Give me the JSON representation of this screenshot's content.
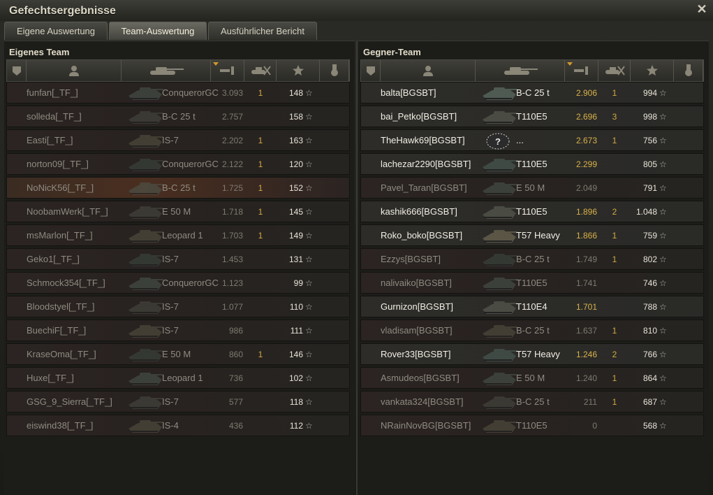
{
  "window": {
    "title": "Gefechtsergebnisse"
  },
  "tabs": [
    {
      "label": "Eigene Auswertung",
      "active": false
    },
    {
      "label": "Team-Auswertung",
      "active": true
    },
    {
      "label": "Ausführlicher Bericht",
      "active": false
    }
  ],
  "left_team": {
    "title": "Eigenes Team",
    "columns": [
      "squad-icon",
      "player-icon",
      "tank-icon",
      "rating-icon",
      "kills-icon",
      "xp-star-icon",
      "medal-icon"
    ],
    "rows": [
      {
        "name": "funfan[_TF_]",
        "vehicle": "ConquerorGC",
        "rating": "3.093",
        "kills": "1",
        "xp": "148",
        "alive": false,
        "hl": false
      },
      {
        "name": "solleda[_TF_]",
        "vehicle": "B-C 25 t",
        "rating": "2.757",
        "kills": "",
        "xp": "158",
        "alive": false,
        "hl": false
      },
      {
        "name": "Easti[_TF_]",
        "vehicle": "IS-7",
        "rating": "2.202",
        "kills": "1",
        "xp": "163",
        "alive": false,
        "hl": false
      },
      {
        "name": "norton09[_TF_]",
        "vehicle": "ConquerorGC",
        "rating": "2.122",
        "kills": "1",
        "xp": "120",
        "alive": false,
        "hl": false
      },
      {
        "name": "NoNicK56[_TF_]",
        "vehicle": "B-C 25 t",
        "rating": "1.725",
        "kills": "1",
        "xp": "152",
        "alive": false,
        "hl": true
      },
      {
        "name": "NoobamWerk[_TF_]",
        "vehicle": "E 50 M",
        "rating": "1.718",
        "kills": "1",
        "xp": "145",
        "alive": false,
        "hl": false
      },
      {
        "name": "msMarlon[_TF_]",
        "vehicle": "Leopard 1",
        "rating": "1.703",
        "kills": "1",
        "xp": "149",
        "alive": false,
        "hl": false
      },
      {
        "name": "Geko1[_TF_]",
        "vehicle": "IS-7",
        "rating": "1.453",
        "kills": "",
        "xp": "131",
        "alive": false,
        "hl": false
      },
      {
        "name": "Schmock354[_TF_]",
        "vehicle": "ConquerorGC",
        "rating": "1.123",
        "kills": "",
        "xp": "99",
        "alive": false,
        "hl": false
      },
      {
        "name": "Bloodstyel[_TF_]",
        "vehicle": "IS-7",
        "rating": "1.077",
        "kills": "",
        "xp": "110",
        "alive": false,
        "hl": false
      },
      {
        "name": "BuechiF[_TF_]",
        "vehicle": "IS-7",
        "rating": "986",
        "kills": "",
        "xp": "111",
        "alive": false,
        "hl": false
      },
      {
        "name": "KraseOma[_TF_]",
        "vehicle": "E 50 M",
        "rating": "860",
        "kills": "1",
        "xp": "146",
        "alive": false,
        "hl": false
      },
      {
        "name": "Huxe[_TF_]",
        "vehicle": "Leopard 1",
        "rating": "736",
        "kills": "",
        "xp": "102",
        "alive": false,
        "hl": false
      },
      {
        "name": "GSG_9_Sierra[_TF_]",
        "vehicle": "IS-7",
        "rating": "577",
        "kills": "",
        "xp": "118",
        "alive": false,
        "hl": false
      },
      {
        "name": "eiswind38[_TF_]",
        "vehicle": "IS-4",
        "rating": "436",
        "kills": "",
        "xp": "112",
        "alive": false,
        "hl": false
      }
    ]
  },
  "right_team": {
    "title": "Gegner-Team",
    "columns": [
      "squad-icon",
      "player-icon",
      "tank-icon",
      "rating-icon",
      "kills-icon",
      "xp-star-icon",
      "medal-icon"
    ],
    "rows": [
      {
        "name": "balta[BGSBT]",
        "vehicle": "B-C 25 t",
        "rating": "2.906",
        "kills": "1",
        "xp": "994",
        "alive": true,
        "hl": false
      },
      {
        "name": "bai_Petko[BGSBT]",
        "vehicle": "T110E5",
        "rating": "2.696",
        "kills": "3",
        "xp": "998",
        "alive": true,
        "hl": false
      },
      {
        "name": "TheHawk69[BGSBT]",
        "vehicle": "...",
        "rating": "2.673",
        "kills": "1",
        "xp": "756",
        "alive": true,
        "hl": false,
        "unknown": true
      },
      {
        "name": "lachezar2290[BGSBT]",
        "vehicle": "T110E5",
        "rating": "2.299",
        "kills": "",
        "xp": "805",
        "alive": true,
        "hl": false
      },
      {
        "name": "Pavel_Taran[BGSBT]",
        "vehicle": "E 50 M",
        "rating": "2.049",
        "kills": "",
        "xp": "791",
        "alive": false,
        "hl": false
      },
      {
        "name": "kashik666[BGSBT]",
        "vehicle": "T110E5",
        "rating": "1.896",
        "kills": "2",
        "xp": "1.048",
        "alive": true,
        "hl": false
      },
      {
        "name": "Roko_boko[BGSBT]",
        "vehicle": "T57 Heavy",
        "rating": "1.866",
        "kills": "1",
        "xp": "759",
        "alive": true,
        "hl": false
      },
      {
        "name": "Ezzys[BGSBT]",
        "vehicle": "B-C 25 t",
        "rating": "1.749",
        "kills": "1",
        "xp": "802",
        "alive": false,
        "hl": false
      },
      {
        "name": "nalivaiko[BGSBT]",
        "vehicle": "T110E5",
        "rating": "1.741",
        "kills": "",
        "xp": "746",
        "alive": false,
        "hl": false
      },
      {
        "name": "Gurnizon[BGSBT]",
        "vehicle": "T110E4",
        "rating": "1.701",
        "kills": "",
        "xp": "788",
        "alive": true,
        "hl": false
      },
      {
        "name": "vladisam[BGSBT]",
        "vehicle": "B-C 25 t",
        "rating": "1.637",
        "kills": "1",
        "xp": "810",
        "alive": false,
        "hl": false
      },
      {
        "name": "Rover33[BGSBT]",
        "vehicle": "T57 Heavy",
        "rating": "1.246",
        "kills": "2",
        "xp": "766",
        "alive": true,
        "hl": false
      },
      {
        "name": "Asmudeos[BGSBT]",
        "vehicle": "E 50 M",
        "rating": "1.240",
        "kills": "1",
        "xp": "864",
        "alive": false,
        "hl": false
      },
      {
        "name": "vankata324[BGSBT]",
        "vehicle": "B-C 25 t",
        "rating": "211",
        "kills": "1",
        "xp": "687",
        "alive": false,
        "hl": false
      },
      {
        "name": "NRainNovBG[BGSBT]",
        "vehicle": "T110E5",
        "rating": "0",
        "kills": "",
        "xp": "568",
        "alive": false,
        "hl": false
      }
    ]
  },
  "colors": {
    "accent": "#d09a2b",
    "kills": "#d2aa42",
    "rating_alive": "#d8b24a"
  }
}
